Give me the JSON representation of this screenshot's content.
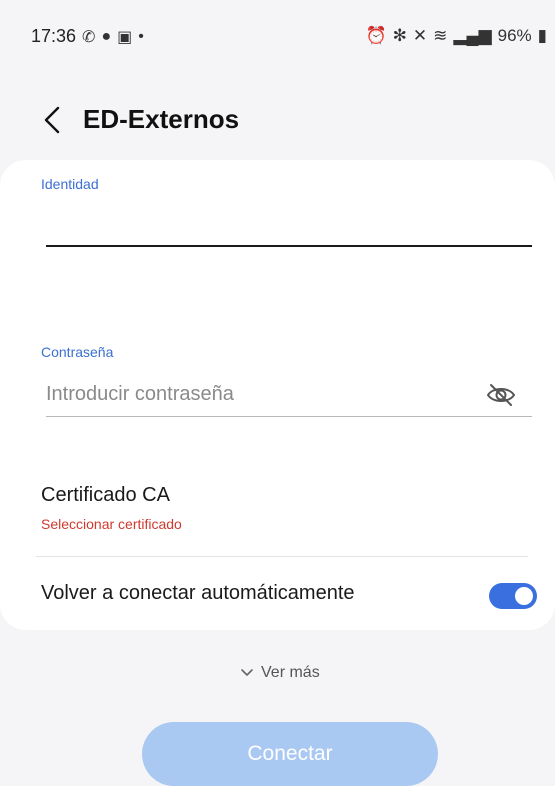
{
  "status_bar": {
    "time": "17:36",
    "battery": "96%"
  },
  "header": {
    "title": "ED-Externos"
  },
  "form": {
    "identity_label": "Identidad",
    "identity_value": "",
    "password_label": "Contraseña",
    "password_placeholder": "Introducir contraseña",
    "password_value": "",
    "ca_cert_title": "Certificado CA",
    "ca_cert_action": "Seleccionar certificado",
    "auto_reconnect_label": "Volver a conectar automáticamente",
    "auto_reconnect_on": true
  },
  "more": {
    "label": "Ver más"
  },
  "actions": {
    "connect_label": "Conectar"
  },
  "colors": {
    "accent": "#3a6fe0",
    "label_blue": "#3b6fd1",
    "error_red": "#d03a2e",
    "connect_disabled": "#a9c8f2"
  },
  "icons": {
    "back": "chevron-left-icon",
    "password_visibility": "eye-off-icon",
    "more": "chevron-down-icon"
  }
}
